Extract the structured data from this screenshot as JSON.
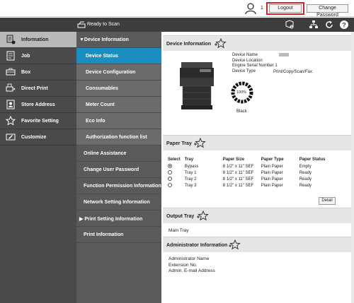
{
  "top": {
    "user_count": "1",
    "logout_label": "Logout",
    "change_password_label": "Change Password"
  },
  "header": {
    "scan_status": "Ready to Scan"
  },
  "leftnav": [
    {
      "label": "Information",
      "icon": "info-icon"
    },
    {
      "label": "Job",
      "icon": "job-icon"
    },
    {
      "label": "Box",
      "icon": "box-icon"
    },
    {
      "label": "Direct Print",
      "icon": "direct-print-icon"
    },
    {
      "label": "Store Address",
      "icon": "address-book-icon"
    },
    {
      "label": "Favorite Setting",
      "icon": "star-icon"
    },
    {
      "label": "Customize",
      "icon": "customize-icon"
    }
  ],
  "midnav": {
    "device_information": "▼Device Information",
    "device_status": "Device Status",
    "device_configuration": "Device Configuration",
    "consumables": "Consumables",
    "meter_count": "Meter Count",
    "eco_info": "Eco Info",
    "authorization_function_list": "Authorization function list",
    "online_assistance": "Online Assistance",
    "change_user_password": "Change User Password",
    "function_permission_information": "Function Permission Information",
    "network_setting_information": "Network Setting Information",
    "print_setting_information": "▶ Print Setting Information",
    "print_information": "Print Information"
  },
  "device_info": {
    "title": "Device Information",
    "labels": [
      "Device Name",
      "Device Location",
      "Engine Serial Number 1",
      "Device Type"
    ],
    "device_type": "Print/Copy/Scan/Fax",
    "toner_percent": "100%",
    "toner_color": "Black"
  },
  "paper_tray": {
    "title": "Paper Tray",
    "headers": [
      "Select",
      "Tray",
      "Paper Size",
      "Paper Type",
      "Paper Status"
    ],
    "rows": [
      {
        "tray": "Bypass",
        "size": "8 1/2\" x 11\" SEF",
        "type": "Plain Paper",
        "status": "Empty"
      },
      {
        "tray": "Tray 1",
        "size": "8 1/2\" x 11\" SEF",
        "type": "Plain Paper",
        "status": "Ready"
      },
      {
        "tray": "Tray 2",
        "size": "8 1/2\" x 11\" SEF",
        "type": "Plain Paper",
        "status": "Ready"
      },
      {
        "tray": "Tray 3",
        "size": "8 1/2\" x 11\" SEF",
        "type": "Plain Paper",
        "status": "Ready"
      }
    ],
    "detail_label": "Detail"
  },
  "output_tray": {
    "title": "Output Tray",
    "main_tray": "Main Tray"
  },
  "admin_info": {
    "title": "Administrator Information",
    "labels": [
      "Administrator Name",
      "Extension No.",
      "Admin. E-mail Address"
    ]
  },
  "colors": {
    "accent": "#1a8ec0",
    "highlight": "#d8202a",
    "dark": "#3d3d3d"
  }
}
